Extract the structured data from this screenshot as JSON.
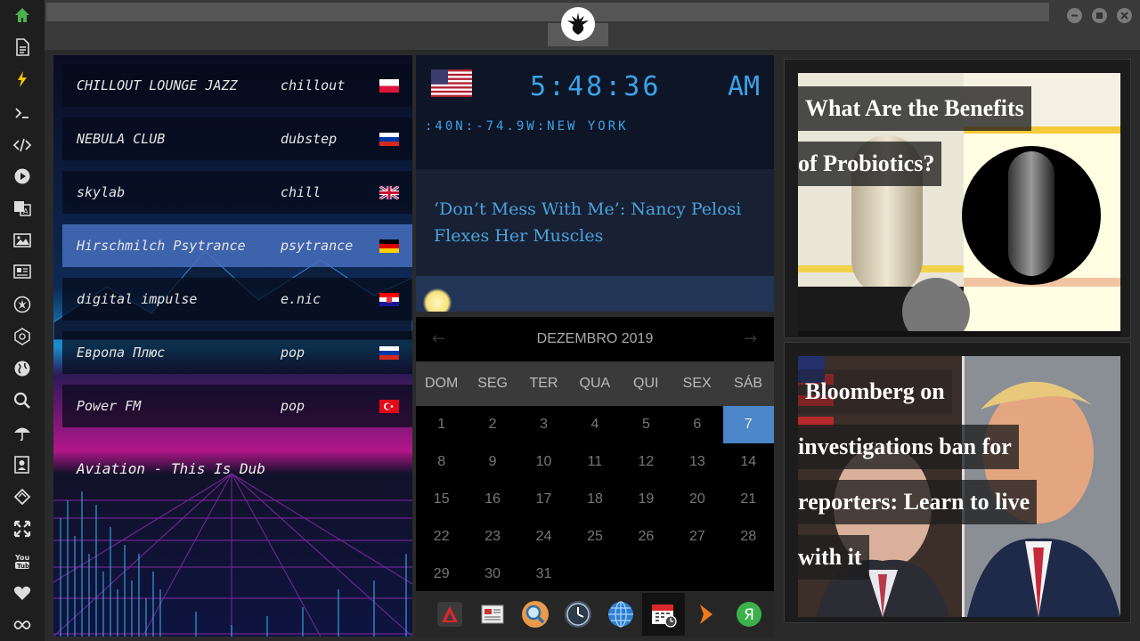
{
  "sidebar": {
    "icons": [
      "home-icon",
      "document-icon",
      "bolt-icon",
      "terminal-icon",
      "code-icon",
      "play-icon",
      "translate-icon",
      "image-icon",
      "news-icon",
      "rebel-icon",
      "galactic-icon",
      "globe-icon",
      "search-icon",
      "umbrella-icon",
      "contact-icon",
      "tag-icon",
      "expand-icon",
      "youtube-icon",
      "heart-icon",
      "infinity-icon"
    ]
  },
  "radio": {
    "stations": [
      {
        "name": "CHILLOUT LOUNGE JAZZ",
        "genre": "chillout",
        "flag": "poland"
      },
      {
        "name": "NEBULA CLUB",
        "genre": "dubstep",
        "flag": "russia"
      },
      {
        "name": "skylab",
        "genre": "chill",
        "flag": "uk"
      },
      {
        "name": "Hirschmilch Psytrance",
        "genre": "psytrance",
        "flag": "germany"
      },
      {
        "name": "digital impulse",
        "genre": "e.nic",
        "flag": "croatia"
      },
      {
        "name": "Европа Плюс",
        "genre": "pop",
        "flag": "russia"
      },
      {
        "name": "Power FM",
        "genre": "pop",
        "flag": "turkey"
      }
    ],
    "now_playing": "Aviation - This Is Dub"
  },
  "clock": {
    "time": "5:48:36",
    "ampm": "AM",
    "location": ":40N:-74.9W:NEW YORK"
  },
  "news_center": {
    "headline": "‘Don’t Mess With Me’: Nancy Pelosi Flexes Her Muscles"
  },
  "calendar": {
    "title": "DEZEMBRO 2019",
    "weekdays": [
      "DOM",
      "SEG",
      "TER",
      "QUA",
      "QUI",
      "SEX",
      "SÁB"
    ],
    "first_weekday": 0,
    "days_in_month": 31,
    "today": 7
  },
  "dock": {
    "icons": [
      "rebel-app-icon",
      "newspaper-icon",
      "search-app-icon",
      "clock-app-icon",
      "globe-app-icon",
      "calendar-app-icon",
      "arrow-app-icon",
      "yandex-icon"
    ]
  },
  "news_right": [
    {
      "lines": [
        "What Are the Benefits",
        "of Probiotics?"
      ]
    },
    {
      "lines": [
        "Bloomberg on",
        "investigations ban for",
        "reporters: Learn to live",
        "with it"
      ]
    }
  ],
  "colors": {
    "accent": "#3aa3e8",
    "today": "#4a86c8",
    "selected_station": "#466ebe"
  }
}
